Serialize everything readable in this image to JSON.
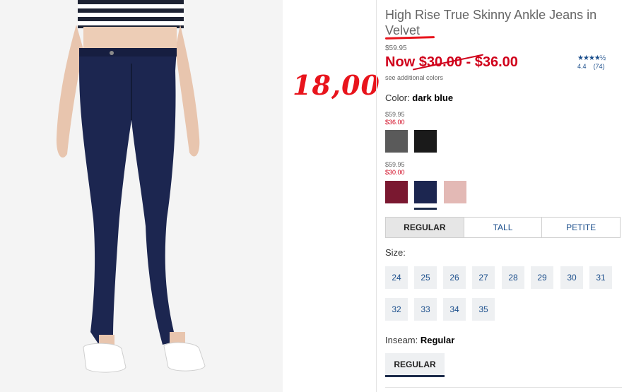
{
  "product": {
    "title": "High Rise True Skinny Ankle Jeans in Velvet",
    "original_price": "$59.95",
    "sale_now": "Now ",
    "sale_range": "$30.00 - $36.00",
    "see_additional": "see additional colors",
    "rating": {
      "stars_glyph": "★★★★½",
      "score": "4.4",
      "count": "(74)"
    }
  },
  "overlay": {
    "handwritten_price": "18,00",
    "annotation_color": "#e8141c"
  },
  "color_selector": {
    "label": "Color: ",
    "selected_name": "dark blue",
    "groups": [
      {
        "original_price": "$59.95",
        "sale_price": "$36.00",
        "swatches": [
          {
            "name": "charcoal",
            "hex": "#5a5a5a"
          },
          {
            "name": "black",
            "hex": "#1a1a1a"
          }
        ]
      },
      {
        "original_price": "$59.95",
        "sale_price": "$30.00",
        "swatches": [
          {
            "name": "burgundy",
            "hex": "#7a1830"
          },
          {
            "name": "dark blue",
            "hex": "#1c2650",
            "selected": true
          },
          {
            "name": "blush pink",
            "hex": "#e3b9b5"
          }
        ]
      }
    ]
  },
  "fit_tabs": [
    {
      "label": "REGULAR",
      "active": true
    },
    {
      "label": "TALL",
      "active": false
    },
    {
      "label": "PETITE",
      "active": false
    }
  ],
  "size": {
    "label": "Size:",
    "options": [
      "24",
      "25",
      "26",
      "27",
      "28",
      "29",
      "30",
      "31",
      "32",
      "33",
      "34",
      "35"
    ]
  },
  "inseam": {
    "label": "Inseam: ",
    "value": "Regular",
    "button": "REGULAR"
  },
  "colors": {
    "sale_red": "#d0021b",
    "link_blue": "#1c4f8c",
    "denim": "#1c2650"
  }
}
